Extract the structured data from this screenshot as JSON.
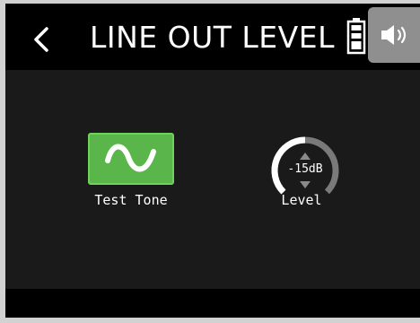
{
  "header": {
    "title": "LINE OUT LEVEL",
    "back_icon": "chevron-left-icon",
    "battery_icon": "battery-icon",
    "speaker_icon": "speaker-icon"
  },
  "controls": {
    "test_tone": {
      "label": "Test Tone",
      "icon": "sine-wave-icon",
      "color": "#5ab54a"
    },
    "level": {
      "label": "Level",
      "value": "-15dB",
      "arc_fill_fraction": 0.5
    }
  },
  "colors": {
    "background": "#1a1a1a",
    "header": "#000000",
    "accent_green": "#5ab54a",
    "speaker_button": "#8f8f8f"
  }
}
